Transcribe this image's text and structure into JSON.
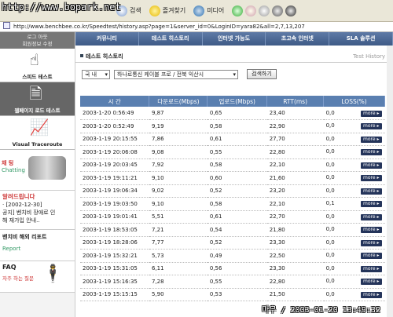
{
  "watermark_top": "http://www.bopark.net",
  "toolbar": {
    "search": "검색",
    "favorites": "즐겨찾기",
    "media": "미디어"
  },
  "address": "http://www.benchbee.co.kr/Speedtest/history.asp?page=1&server_id=0&LoginID=yara82&all=2,7,13,207",
  "nav": [
    "커뮤니티",
    "테스트 히스토리",
    "인터넷 가능도",
    "초고속 인터넷",
    "SLA 솔루션"
  ],
  "sidebar": {
    "top_line1": "로그 아웃",
    "top_line2": "회원정보 수정",
    "tab_speed": "스피드 테스트",
    "tab_web": "웹페이지 로드 테스트",
    "tab_trace": "Visual Traceroute",
    "chat_title": "채 팅",
    "chat_sub": "Chatting",
    "notice_title": "알려드립니다",
    "notice_l1": "· [2002-12-30]",
    "notice_l2": "공지] 벤치비 장애로 인",
    "notice_l3": "해 재가입 안내..",
    "report_title": "벤치비 해외 리포트",
    "report_sub": "Report",
    "faq_title": "FAQ",
    "faq_sub": "자주 하는 질문"
  },
  "section": {
    "title": "테스트 히스토리",
    "eng": "Test History"
  },
  "filters": {
    "region": "국 내",
    "isp": "하나로통신 케이블 프로 / 전북 익산시",
    "button": "검색하기"
  },
  "table": {
    "headers": [
      "시 간",
      "다운로드(Mbps)",
      "업로드(Mbps)",
      "RTT(ms)",
      "LOSS(%)"
    ],
    "more_label": "more",
    "rows": [
      [
        "2003-1-20  0:56:49",
        "9,87",
        "0,65",
        "23,40",
        "0,0"
      ],
      [
        "2003-1-20  0:52:49",
        "9,19",
        "0,58",
        "22,90",
        "0,0"
      ],
      [
        "2003-1-19 20:15:55",
        "7,86",
        "0,61",
        "27,70",
        "0,0"
      ],
      [
        "2003-1-19 20:06:08",
        "9,08",
        "0,55",
        "22,80",
        "0,0"
      ],
      [
        "2003-1-19 20:03:45",
        "7,92",
        "0,58",
        "22,10",
        "0,0"
      ],
      [
        "2003-1-19 19:11:21",
        "9,10",
        "0,60",
        "21,60",
        "0,0"
      ],
      [
        "2003-1-19 19:06:34",
        "9,02",
        "0,52",
        "23,20",
        "0,0"
      ],
      [
        "2003-1-19 19:03:50",
        "9,10",
        "0,58",
        "22,10",
        "0,1"
      ],
      [
        "2003-1-19 19:01:41",
        "5,51",
        "0,61",
        "22,70",
        "0,0"
      ],
      [
        "2003-1-19 18:53:05",
        "7,21",
        "0,54",
        "21,80",
        "0,0"
      ],
      [
        "2003-1-19 18:28:06",
        "7,77",
        "0,52",
        "23,30",
        "0,0"
      ],
      [
        "2003-1-19 15:32:21",
        "5,73",
        "0,49",
        "22,50",
        "0,0"
      ],
      [
        "2003-1-19 15:31:05",
        "6,11",
        "0,56",
        "23,30",
        "0,0"
      ],
      [
        "2003-1-19 15:16:35",
        "7,28",
        "0,55",
        "22,80",
        "0,0"
      ],
      [
        "2003-1-19 15:15:15",
        "5,90",
        "0,53",
        "21,50",
        "0,0"
      ]
    ]
  },
  "stamp": "마우 / 2003-01-20 13:49:32"
}
